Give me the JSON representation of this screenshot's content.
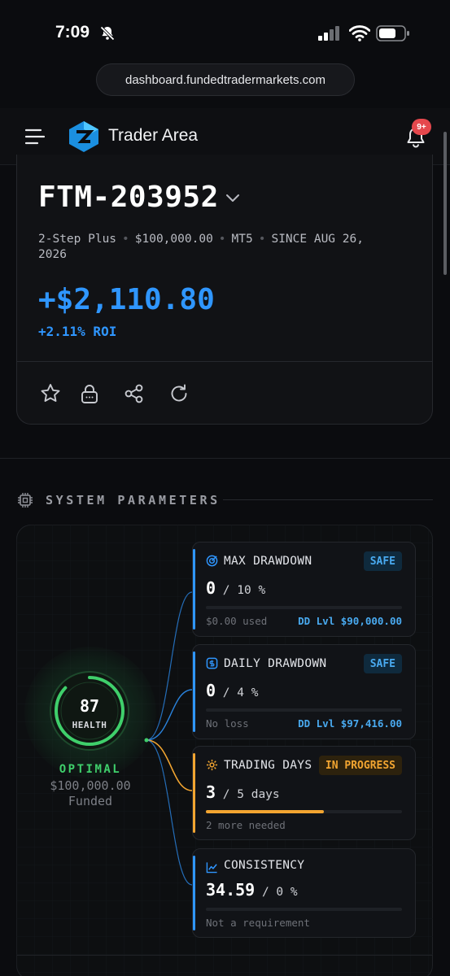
{
  "status_bar": {
    "time": "7:09"
  },
  "browser": {
    "url": "dashboard.fundedtradermarkets.com"
  },
  "header": {
    "brand": "Trader Area",
    "notifications_badge": "9+"
  },
  "account": {
    "id": "FTM-203952",
    "program": "2-Step Plus",
    "size": "$100,000.00",
    "platform": "MT5",
    "since": "SINCE AUG 26,",
    "since_year": "2026",
    "pnl": "+$2,110.80",
    "roi": "+2.11% ROI",
    "actions": [
      "star-icon",
      "lock-icon",
      "share-icon",
      "refresh-icon"
    ]
  },
  "system": {
    "title": "SYSTEM PARAMETERS",
    "health": {
      "score": "87",
      "label": "HEALTH",
      "status": "OPTIMAL",
      "amount": "$100,000.00",
      "sub": "Funded",
      "ring_fraction": 0.87
    },
    "cards": [
      {
        "title": "MAX DRAWDOWN",
        "tag": "SAFE",
        "value": "0",
        "limit": "10 %",
        "footer_left": "$0.00 used",
        "footer_right": "DD Lvl $90,000.00",
        "progress": 0,
        "bar_color": "#2f96ff"
      },
      {
        "title": "DAILY DRAWDOWN",
        "tag": "SAFE",
        "value": "0",
        "limit": "4 %",
        "footer_left": "No loss",
        "footer_right": "DD Lvl $97,416.00",
        "progress": 0,
        "bar_color": "#2f96ff"
      },
      {
        "title": "TRADING DAYS",
        "tag": "IN PROGRESS",
        "value": "3",
        "limit": "5 days",
        "footer_left": "2 more needed",
        "footer_right": "",
        "progress": 0.6,
        "bar_color": "#f2a531"
      },
      {
        "title": "CONSISTENCY",
        "tag": "",
        "value": "34.59",
        "limit": "0 %",
        "footer_left": "Not a requirement",
        "footer_right": "",
        "progress": 0,
        "bar_color": "#2f96ff"
      }
    ]
  },
  "colors": {
    "accent": "#2f96ff",
    "success": "#3fcf6b",
    "warning": "#f2a531",
    "danger": "#e5484d"
  }
}
